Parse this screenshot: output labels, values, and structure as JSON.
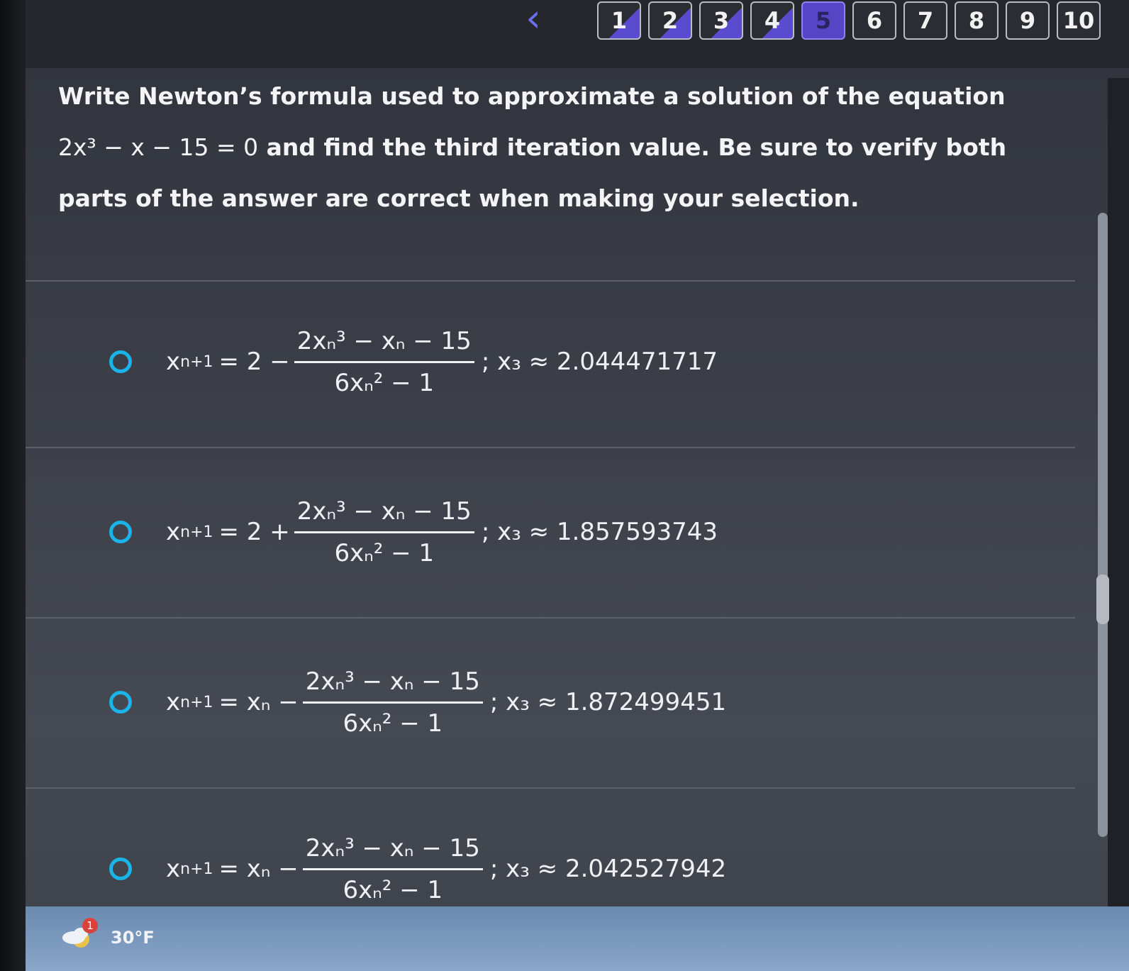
{
  "nav": {
    "back_icon": "chevron-left-icon",
    "pages": [
      {
        "label": "1",
        "state": "visited"
      },
      {
        "label": "2",
        "state": "visited"
      },
      {
        "label": "3",
        "state": "visited"
      },
      {
        "label": "4",
        "state": "visited"
      },
      {
        "label": "5",
        "state": "current"
      },
      {
        "label": "6",
        "state": "unvisited"
      },
      {
        "label": "7",
        "state": "unvisited"
      },
      {
        "label": "8",
        "state": "unvisited"
      },
      {
        "label": "9",
        "state": "unvisited"
      },
      {
        "label": "10",
        "state": "unvisited"
      }
    ]
  },
  "question": {
    "text_part1": "Write Newton’s formula used to approximate a solution of the equation",
    "equation": "2x³ − x − 15 = 0",
    "text_part2": " and find the third iteration value. Be sure to verify both parts of the answer are correct when making your selection."
  },
  "options": [
    {
      "lhs": "x",
      "lhs_sub": "n+1",
      "rhs_prefix": "= 2 −",
      "numerator": "2xₙ³ − xₙ − 15",
      "denominator": "6xₙ² − 1",
      "answer": "; x₃ ≈ 2.044471717"
    },
    {
      "lhs": "x",
      "lhs_sub": "n+1",
      "rhs_prefix": "= 2 +",
      "numerator": "2xₙ³ − xₙ − 15",
      "denominator": "6xₙ² − 1",
      "answer": "; x₃ ≈ 1.857593743"
    },
    {
      "lhs": "x",
      "lhs_sub": "n+1",
      "rhs_prefix": "= xₙ −",
      "numerator": "2xₙ³ − xₙ − 15",
      "denominator": "6xₙ² − 1",
      "answer": "; x₃ ≈ 1.872499451"
    },
    {
      "lhs": "x",
      "lhs_sub": "n+1",
      "rhs_prefix": "= xₙ −",
      "numerator": "2xₙ³ − xₙ − 15",
      "denominator": "6xₙ² − 1",
      "answer": "; x₃ ≈ 2.042527942"
    }
  ],
  "taskbar": {
    "weather_badge": "1",
    "temperature": "30°F",
    "weather_icon": "weather-cloud-icon"
  },
  "colors": {
    "accent": "#5646c6",
    "radio": "#1ab4e8",
    "text": "#eef0f4"
  }
}
